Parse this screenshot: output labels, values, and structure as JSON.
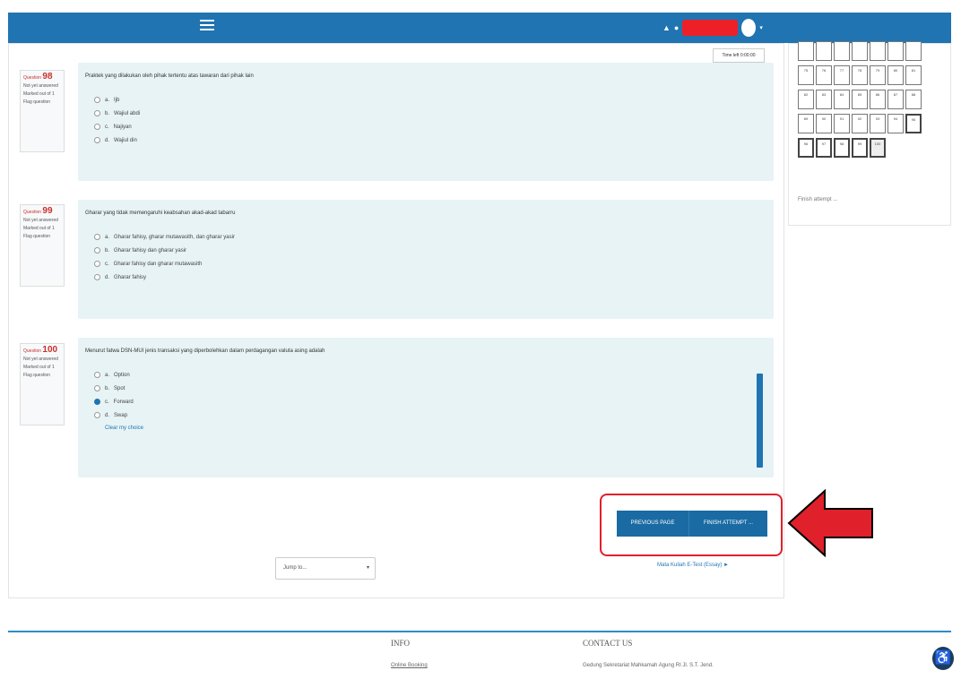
{
  "header": {
    "menu_icon": "hamburger-icon",
    "user_icons": [
      "person-icon",
      "dot-icon"
    ],
    "dropdown_caret": "▾"
  },
  "timer": {
    "text": "Time left 0:00:00"
  },
  "questions": [
    {
      "number_label": "Question",
      "number": "98",
      "status": "Not yet answered",
      "marks": "Marked out of 1",
      "flag": "Flag question",
      "text": "Praktek yang dilakukan oleh pihak tertentu atas tawaran dari pihak lain",
      "options": [
        {
          "letter": "a.",
          "text": "Ijb",
          "checked": false
        },
        {
          "letter": "b.",
          "text": "Wajiul abdi",
          "checked": false
        },
        {
          "letter": "c.",
          "text": "Najiyan",
          "checked": false
        },
        {
          "letter": "d.",
          "text": "Wajiul din",
          "checked": false
        }
      ]
    },
    {
      "number_label": "Question",
      "number": "99",
      "status": "Not yet answered",
      "marks": "Marked out of 1",
      "flag": "Flag question",
      "text": "Gharar yang tidak memengaruhi keabsahan akad-akad tabarru",
      "options": [
        {
          "letter": "a.",
          "text": "Gharar fahisy, gharar mutawasith, dan gharar yasir",
          "checked": false
        },
        {
          "letter": "b.",
          "text": "Gharar fahisy dan gharar yasir",
          "checked": false
        },
        {
          "letter": "c.",
          "text": "Gharar fahisy dan gharar mutawasith",
          "checked": false
        },
        {
          "letter": "d.",
          "text": "Gharar fahisy",
          "checked": false
        }
      ]
    },
    {
      "number_label": "Question",
      "number": "100",
      "status": "Not yet answered",
      "marks": "Marked out of 1",
      "flag": "Flag question",
      "text": "Menurut fatwa DSN-MUI jenis transaksi yang diperbolehkan dalam perdagangan valuta asing adalah",
      "options": [
        {
          "letter": "a.",
          "text": "Option",
          "checked": false
        },
        {
          "letter": "b.",
          "text": "Spot",
          "checked": false
        },
        {
          "letter": "c.",
          "text": "Forward",
          "checked": true
        },
        {
          "letter": "d.",
          "text": "Swap",
          "checked": false
        }
      ],
      "clear_choice": "Clear my choice"
    }
  ],
  "buttons": {
    "previous": "PREVIOUS PAGE",
    "finish": "FINISH ATTEMPT ..."
  },
  "jump": {
    "placeholder": "Jump to...",
    "caret": "▾"
  },
  "next_link": "Mata Kuliah E-Test (Essay) ►",
  "navigation": {
    "rows": [
      [
        "",
        "",
        "",
        "",
        "",
        "",
        ""
      ],
      [
        "75",
        "76",
        "77",
        "78",
        "79",
        "80",
        "81"
      ],
      [
        "82",
        "83",
        "84",
        "85",
        "86",
        "87",
        "88"
      ],
      [
        "89",
        "90",
        "91",
        "92",
        "93",
        "94",
        "95"
      ],
      [
        "96",
        "97",
        "98",
        "99",
        "100"
      ]
    ],
    "finish_link": "Finish attempt ..."
  },
  "footer": {
    "info_heading": "INFO",
    "info_link": "Online Booking",
    "contact_heading": "CONTACT US",
    "contact_text": "Gedung Sekretariat Mahkamah Agung RI Jl. S.T. Jend."
  },
  "colors": {
    "primary": "#1f74b1",
    "highlight_red": "#e0202a",
    "question_bg": "#e7f3f5"
  }
}
